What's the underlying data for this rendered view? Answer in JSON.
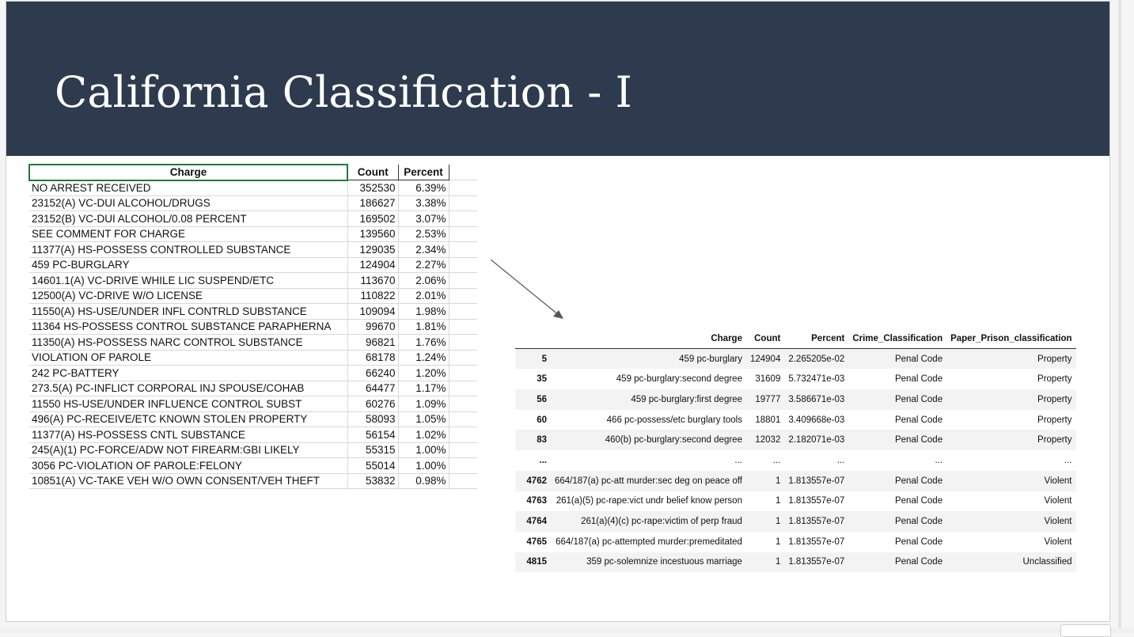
{
  "slide": {
    "title": "California Classification - I"
  },
  "excel_table": {
    "headers": [
      "Charge",
      "Count",
      "Percent"
    ],
    "rows": [
      [
        "NO ARREST RECEIVED",
        "352530",
        "6.39%"
      ],
      [
        "23152(A) VC-DUI ALCOHOL/DRUGS",
        "186627",
        "3.38%"
      ],
      [
        "23152(B) VC-DUI ALCOHOL/0.08 PERCENT",
        "169502",
        "3.07%"
      ],
      [
        "SEE COMMENT FOR CHARGE",
        "139560",
        "2.53%"
      ],
      [
        "11377(A) HS-POSSESS CONTROLLED SUBSTANCE",
        "129035",
        "2.34%"
      ],
      [
        "459 PC-BURGLARY",
        "124904",
        "2.27%"
      ],
      [
        "14601.1(A) VC-DRIVE WHILE LIC SUSPEND/ETC",
        "113670",
        "2.06%"
      ],
      [
        "12500(A) VC-DRIVE W/O LICENSE",
        "110822",
        "2.01%"
      ],
      [
        "11550(A) HS-USE/UNDER INFL CONTRLD SUBSTANCE",
        "109094",
        "1.98%"
      ],
      [
        "11364 HS-POSSESS CONTROL SUBSTANCE PARAPHERNA",
        "99670",
        "1.81%"
      ],
      [
        "11350(A) HS-POSSESS NARC CONTROL SUBSTANCE",
        "96821",
        "1.76%"
      ],
      [
        "VIOLATION OF PAROLE",
        "68178",
        "1.24%"
      ],
      [
        "242 PC-BATTERY",
        "66240",
        "1.20%"
      ],
      [
        "273.5(A) PC-INFLICT CORPORAL INJ SPOUSE/COHAB",
        "64477",
        "1.17%"
      ],
      [
        "11550 HS-USE/UNDER INFLUENCE CONTROL SUBST",
        "60276",
        "1.09%"
      ],
      [
        "496(A) PC-RECEIVE/ETC KNOWN STOLEN PROPERTY",
        "58093",
        "1.05%"
      ],
      [
        "11377(A) HS-POSSESS CNTL SUBSTANCE",
        "56154",
        "1.02%"
      ],
      [
        "245(A)(1) PC-FORCE/ADW NOT FIREARM:GBI LIKELY",
        "55315",
        "1.00%"
      ],
      [
        "3056 PC-VIOLATION OF PAROLE:FELONY",
        "55014",
        "1.00%"
      ],
      [
        "10851(A) VC-TAKE VEH W/O OWN CONSENT/VEH THEFT",
        "53832",
        "0.98%"
      ]
    ]
  },
  "pandas_table": {
    "headers": [
      "",
      "Charge",
      "Count",
      "Percent",
      "Crime_Classification",
      "Paper_Prison_classification"
    ],
    "rows": [
      [
        "5",
        "459 pc-burglary",
        "124904",
        "2.265205e-02",
        "Penal Code",
        "Property"
      ],
      [
        "35",
        "459 pc-burglary:second degree",
        "31609",
        "5.732471e-03",
        "Penal Code",
        "Property"
      ],
      [
        "56",
        "459 pc-burglary:first degree",
        "19777",
        "3.586671e-03",
        "Penal Code",
        "Property"
      ],
      [
        "60",
        "466 pc-possess/etc burglary tools",
        "18801",
        "3.409668e-03",
        "Penal Code",
        "Property"
      ],
      [
        "83",
        "460(b) pc-burglary:second degree",
        "12032",
        "2.182071e-03",
        "Penal Code",
        "Property"
      ],
      [
        "...",
        "...",
        "...",
        "...",
        "...",
        "..."
      ],
      [
        "4762",
        "664/187(a) pc-att murder:sec deg on peace off",
        "1",
        "1.813557e-07",
        "Penal Code",
        "Violent"
      ],
      [
        "4763",
        "261(a)(5) pc-rape:vict undr belief know person",
        "1",
        "1.813557e-07",
        "Penal Code",
        "Violent"
      ],
      [
        "4764",
        "261(a)(4)(c) pc-rape:victim of perp fraud",
        "1",
        "1.813557e-07",
        "Penal Code",
        "Violent"
      ],
      [
        "4765",
        "664/187(a) pc-attempted murder:premeditated",
        "1",
        "1.813557e-07",
        "Penal Code",
        "Violent"
      ],
      [
        "4815",
        "359 pc-solemnize incestuous marriage",
        "1",
        "1.813557e-07",
        "Penal Code",
        "Unclassified"
      ]
    ]
  },
  "icons": {
    "arrow": "arrow-down-right-icon"
  },
  "colors": {
    "header_bg": "#2e3a4d",
    "title_text": "#ffffff",
    "excel_selection": "#1f7a3f"
  }
}
